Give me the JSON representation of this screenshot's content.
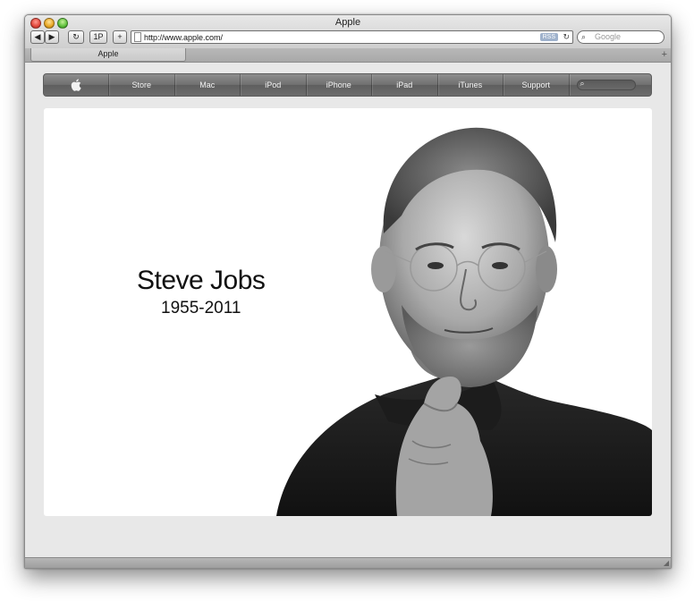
{
  "window": {
    "title": "Apple"
  },
  "toolbar": {
    "back_label": "◀",
    "forward_label": "▶",
    "reload_label": "↻",
    "onepassword_label": "1P",
    "add_label": "+",
    "url": "http://www.apple.com/",
    "rss_label": "RSS",
    "address_reload_label": "↻",
    "search_placeholder": "Google",
    "search_icon": "⌕"
  },
  "tabs": [
    {
      "label": "Apple"
    }
  ],
  "new_tab_label": "+",
  "nav": {
    "apple_logo": "",
    "items": [
      {
        "label": "Store"
      },
      {
        "label": "Mac"
      },
      {
        "label": "iPod"
      },
      {
        "label": "iPhone"
      },
      {
        "label": "iPad"
      },
      {
        "label": "iTunes"
      },
      {
        "label": "Support"
      }
    ],
    "search_icon": "⌕"
  },
  "hero": {
    "name": "Steve Jobs",
    "years": "1955-2011"
  }
}
